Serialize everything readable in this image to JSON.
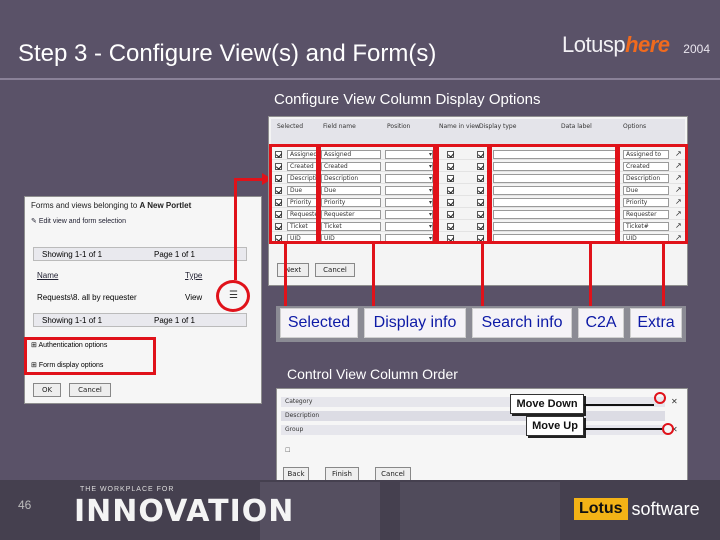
{
  "slide": {
    "title": "Step 3 - Configure View(s) and Form(s)",
    "page_number": "46",
    "logo": {
      "lotus": "Lotusp",
      "here": "here",
      "year": "2004"
    }
  },
  "sections": {
    "view_options_label": "Configure View Column Display Options",
    "column_order_label": "Control View Column Order"
  },
  "legend_pills": [
    {
      "label": "Selected"
    },
    {
      "label": "Display info"
    },
    {
      "label": "Search info"
    },
    {
      "label": "C2A"
    },
    {
      "label": "Extra"
    }
  ],
  "order_buttons": {
    "move_down": "Move Down",
    "move_up": "Move Up"
  },
  "left_panel": {
    "heading": "Forms and views belonging to",
    "portlet_name": "A New Portlet",
    "edit_link": "Edit view and form selection",
    "pager_top": "Showing 1-1 of 1",
    "page_top": "Page 1 of 1",
    "col_name": "Name",
    "col_type": "Type",
    "row_name": "Requests\\8. all by requester",
    "row_type": "View",
    "pager_bottom": "Showing 1-1 of 1",
    "page_bottom": "Page 1 of 1",
    "auth_options": "Authentication options",
    "form_options": "Form display options",
    "ok": "OK",
    "cancel": "Cancel"
  },
  "view_table": {
    "headers": [
      "Selected",
      "Field name",
      "Position",
      "Name in view",
      "Display type",
      "",
      "Data label",
      "",
      "Options"
    ],
    "rows": [
      {
        "field": "Assigned",
        "display": "Assigned to"
      },
      {
        "field": "Created",
        "display": "Created"
      },
      {
        "field": "Description",
        "display": "Description"
      },
      {
        "field": "Due",
        "display": "Due"
      },
      {
        "field": "Priority",
        "display": "Priority"
      },
      {
        "field": "Requester",
        "display": "Requester"
      },
      {
        "field": "Ticket",
        "display": "Ticket#"
      },
      {
        "field": "UID",
        "display": "UID"
      }
    ],
    "next_btn": "Next",
    "cancel_btn": "Cancel"
  },
  "order_table": {
    "rows": [
      "Category",
      "Description",
      "Group"
    ],
    "back_btn": "Back",
    "finish_btn": "Finish",
    "cancel_btn": "Cancel"
  },
  "footer": {
    "tagline": "THE WORKPLACE FOR",
    "brand": "INNOVATION",
    "vendor": "Lotus",
    "vendor_suffix": "software"
  },
  "colors": {
    "background": "#5a5268",
    "highlight_red": "#e0121a",
    "pill_text": "#0d1aa6",
    "logo_orange": "#f06a1e"
  }
}
